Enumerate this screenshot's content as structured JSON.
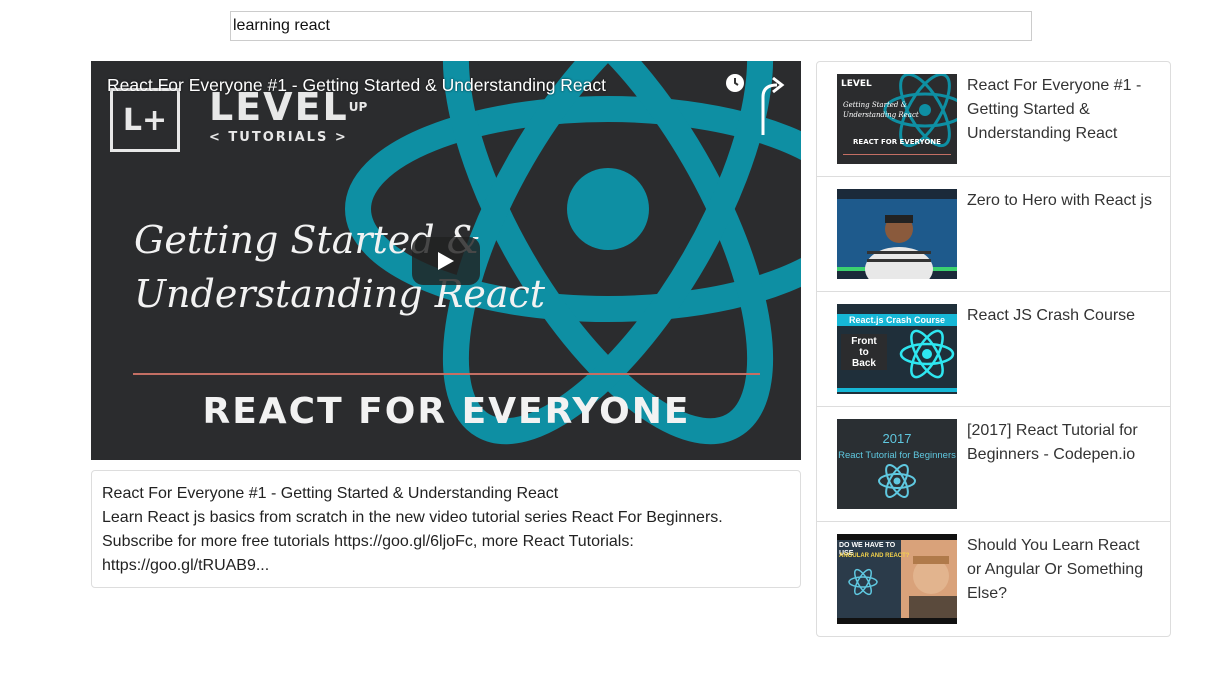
{
  "search": {
    "value": "learning react",
    "placeholder": ""
  },
  "player": {
    "overlay_title": "React For Everyone #1 - Getting Started & Understanding React",
    "logo_mark": "L+",
    "logo_word": "LEVEL",
    "logo_word_sup": "UP",
    "logo_sub": "< TUTORIALS >",
    "thumb_title_line1": "Getting Started &",
    "thumb_title_line2": "Understanding React",
    "thumb_caption": "REACT FOR EVERYONE",
    "accent_color": "#0e8fa3"
  },
  "details": {
    "title": "React For Everyone #1 - Getting Started & Understanding React",
    "description": "Learn React js basics from scratch in the new video tutorial series React For Beginners. Subscribe for more free tutorials https://goo.gl/6ljoFc, more React Tutorials: https://goo.gl/tRUAB9..."
  },
  "video_list": [
    {
      "title": "React For Everyone #1 - Getting Started & Understanding React",
      "thumb": {
        "logo": "LEVEL",
        "line1": "Getting Started &",
        "line2": "Understanding React",
        "caption": "REACT FOR EVERYONE"
      }
    },
    {
      "title": "Zero to Hero with React js"
    },
    {
      "title": "React JS Crash Course",
      "thumb": {
        "banner": "React.js Crash Course",
        "box_line1": "Front",
        "box_line2": "to",
        "box_line3": "Back"
      }
    },
    {
      "title": "[2017] React Tutorial for Beginners - Codepen.io",
      "thumb": {
        "year": "2017",
        "subtitle": "React Tutorial for Beginners"
      }
    },
    {
      "title": "Should You Learn React or Angular Or Something Else?",
      "thumb": {
        "headline": "DO WE HAVE TO USE",
        "tag": "ANGULAR AND REACT?"
      }
    }
  ]
}
